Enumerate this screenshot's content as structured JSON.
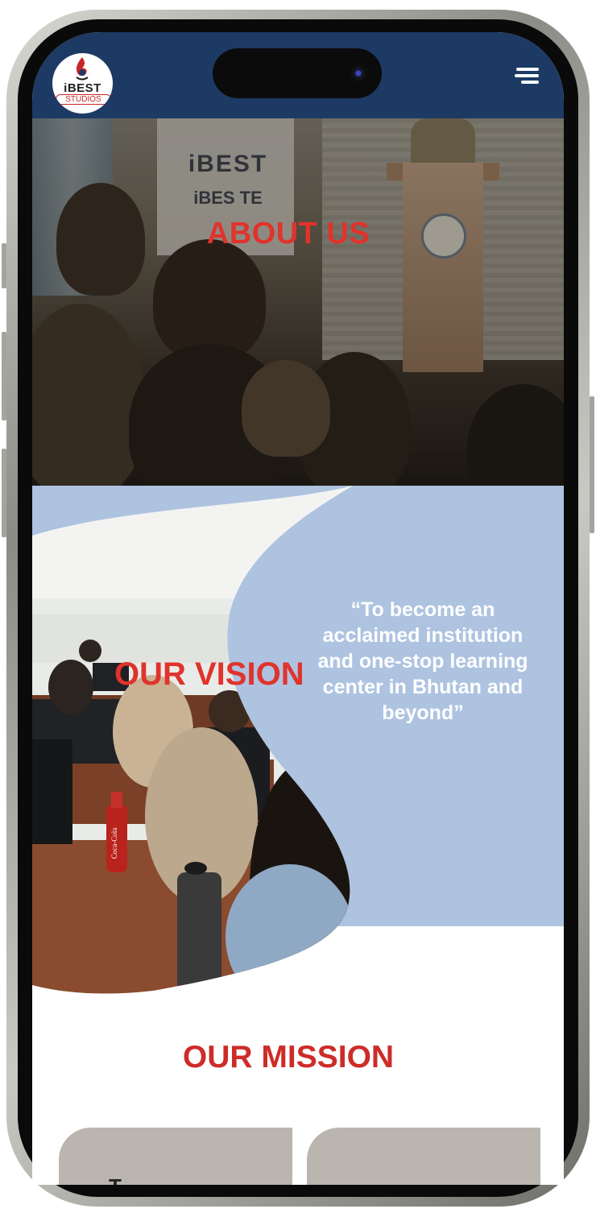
{
  "header": {
    "logo": {
      "line1": "iBEST",
      "line2": "STUDIOS"
    },
    "menu_icon": "hamburger-menu-icon"
  },
  "hero": {
    "title": "ABOUT US",
    "photo_banner_text": "iBEST",
    "photo_banner_sub": "iBES     TE"
  },
  "vision": {
    "title": "OUR VISION",
    "quote": "“To become an acclaimed institution and one-stop learning center in Bhutan and beyond”",
    "bottle_label": "Coca-Cola"
  },
  "mission": {
    "title": "OUR MISSION",
    "cards": [
      {
        "text": "T"
      },
      {
        "text": ""
      }
    ]
  },
  "colors": {
    "header_bg": "#1d3a64",
    "accent_red": "#e0332c",
    "vision_bg": "#adc3e0",
    "card_bg": "#bab5ae"
  }
}
